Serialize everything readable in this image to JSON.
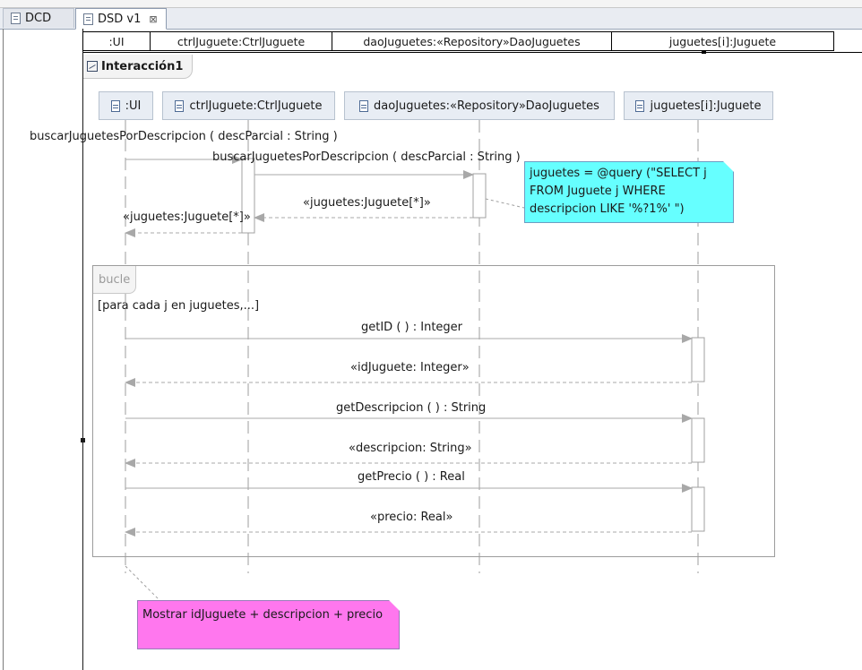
{
  "tabs": [
    {
      "label": "DCD",
      "active": false
    },
    {
      "label": "DSD v1",
      "active": true
    }
  ],
  "header_cells": [
    ":UI",
    "ctrlJuguete:CtrlJuguete",
    "daoJuguetes:«Repository»DaoJuguetes",
    "juguetes[i]:Juguete"
  ],
  "interaction_title": "Interacción1",
  "lifelines": [
    {
      "name": ":UI"
    },
    {
      "name": "ctrlJuguete:CtrlJuguete"
    },
    {
      "name": "daoJuguetes:«Repository»DaoJuguetes"
    },
    {
      "name": "juguetes[i]:Juguete"
    }
  ],
  "messages": {
    "m1": "buscarJuguetesPorDescripcion ( descParcial : String )",
    "m2": "buscarJuguetesPorDescripcion ( descParcial : String )",
    "r2": "«juguetes:Juguete[*]»",
    "r1": "«juguetes:Juguete[*]»",
    "m3": "getID ( ) : Integer",
    "r3": "«idJuguete: Integer»",
    "m4": "getDescripcion ( ) : String",
    "r4": "«descripcion: String»",
    "m5": "getPrecio ( ) : Real",
    "r5": "«precio: Real»"
  },
  "loop": {
    "operator": "bucle",
    "guard": "[para cada j en juguetes,...]"
  },
  "notes": {
    "query_lines": [
      "juguetes = @query (\"SELECT j",
      "FROM Juguete j WHERE",
      "descripcion LIKE '%?1%' \")"
    ],
    "display": "Mostrar idJuguete + descripcion + precio"
  },
  "colors": {
    "query_note": "#66ffff",
    "display_note": "#ff77ee",
    "lifeline_fill": "#e8edf4",
    "message_line": "#9c9c9c"
  }
}
